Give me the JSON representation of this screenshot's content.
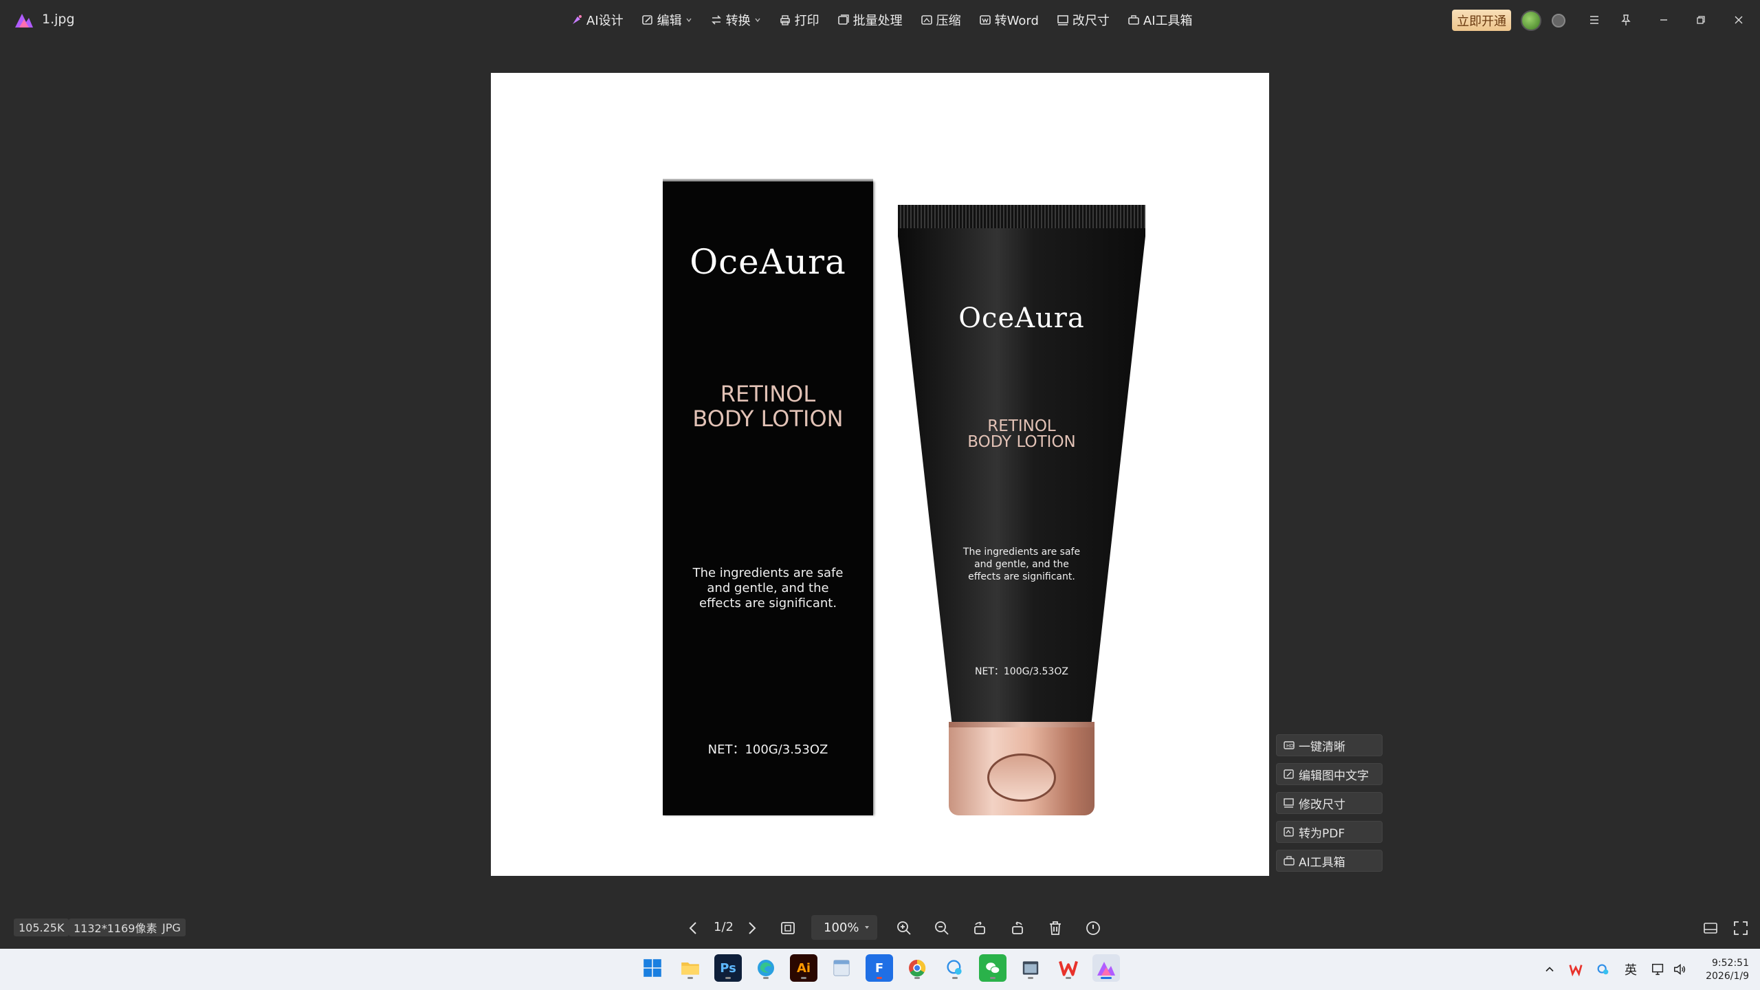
{
  "titlebar": {
    "file_name": "1.jpg",
    "toolbar": [
      {
        "label": "AI设计",
        "icon": "ai-design-icon",
        "caret": false
      },
      {
        "label": "编辑",
        "icon": "edit-icon",
        "caret": true
      },
      {
        "label": "转换",
        "icon": "convert-icon",
        "caret": true
      },
      {
        "label": "打印",
        "icon": "print-icon",
        "caret": false
      },
      {
        "label": "批量处理",
        "icon": "batch-icon",
        "caret": false
      },
      {
        "label": "压缩",
        "icon": "compress-icon",
        "caret": false
      },
      {
        "label": "转Word",
        "icon": "to-word-icon",
        "caret": false
      },
      {
        "label": "改尺寸",
        "icon": "resize-icon",
        "caret": false
      },
      {
        "label": "AI工具箱",
        "icon": "ai-toolbox-icon",
        "caret": false
      }
    ],
    "vip_label": "立即开通"
  },
  "image": {
    "box": {
      "brand": "OceAura",
      "product_line1": "RETINOL",
      "product_line2": "BODY LOTION",
      "tagline_line1": "The ingredients are safe",
      "tagline_line2": "and gentle, and the",
      "tagline_line3": "effects are significant.",
      "net": "NET：100G/3.53OZ"
    },
    "tube": {
      "brand": "OceAura",
      "product_line1": "RETINOL",
      "product_line2": "BODY LOTION",
      "tagline_line1": "The ingredients are safe",
      "tagline_line2": "and gentle, and the",
      "tagline_line3": "effects are significant.",
      "net": "NET：100G/3.53OZ"
    }
  },
  "side_actions": [
    {
      "label": "一键清晰",
      "icon": "enhance-icon"
    },
    {
      "label": "编辑图中文字",
      "icon": "edit-text-icon"
    },
    {
      "label": "修改尺寸",
      "icon": "resize-icon"
    },
    {
      "label": "转为PDF",
      "icon": "pdf-icon"
    },
    {
      "label": "AI工具箱",
      "icon": "ai-toolbox-icon"
    }
  ],
  "status": {
    "file_size": "105.25K",
    "dimensions": "1132*1169像素",
    "format": "JPG"
  },
  "viewer": {
    "page_indicator": "1/2",
    "zoom": "100%"
  },
  "clock": {
    "time": "9:52:51",
    "date": "2026/1/9"
  },
  "tray": {
    "ime": "英"
  },
  "colors": {
    "background": "#2b2b2b",
    "vip_gold": "#eec68d",
    "label_rose": "#e2c2b6",
    "cap_rose_gold": "#e8b7a2"
  }
}
